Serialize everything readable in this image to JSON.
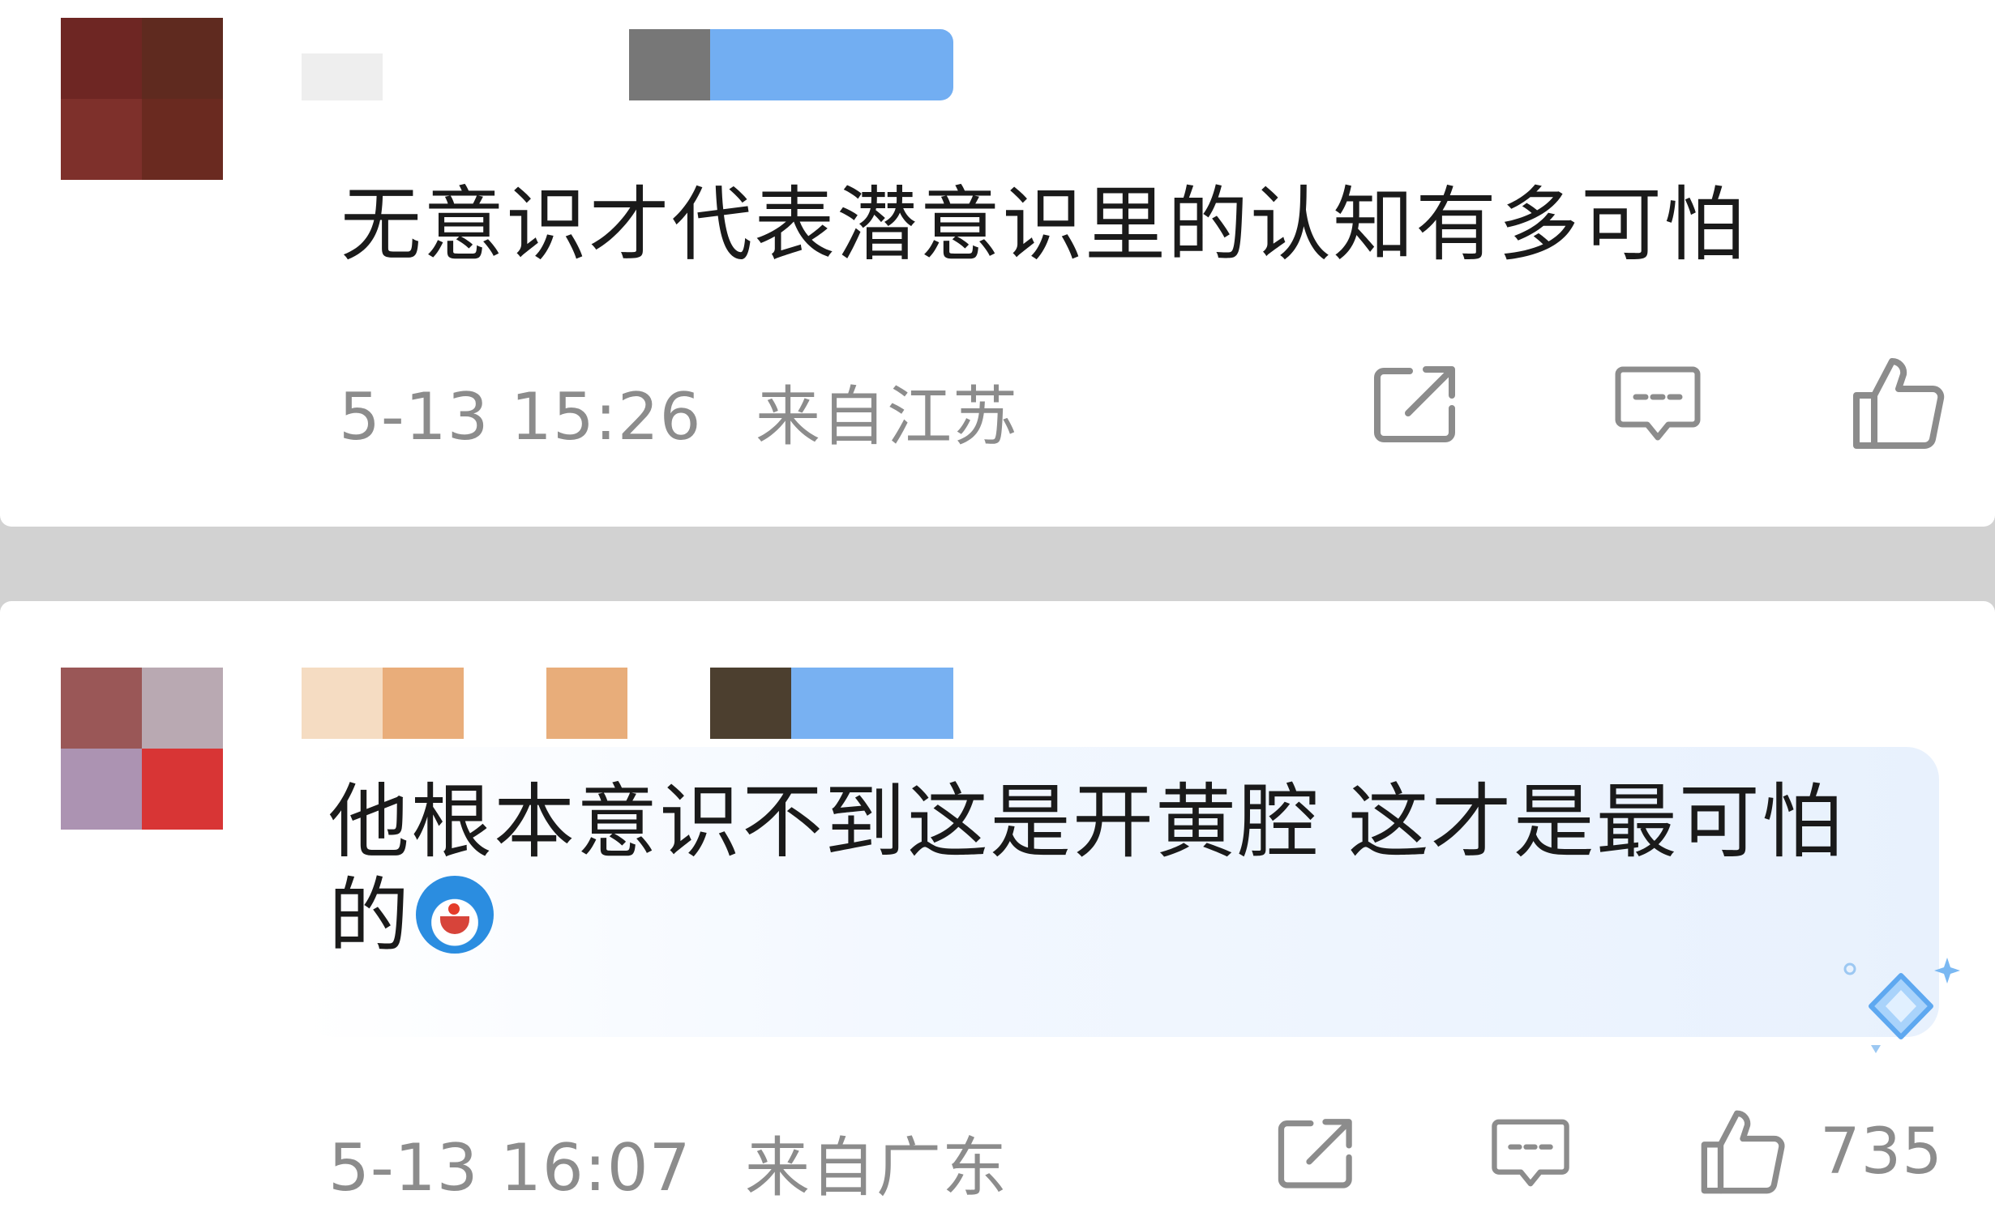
{
  "comments": [
    {
      "text": "无意识才代表潜意识里的认知有多可怕",
      "time": "5-13 15:26",
      "location": "来自江苏",
      "likes": "",
      "avatar_colors": [
        "#6e2623",
        "#5f2a1f",
        "#7e302b",
        "#6a2a20",
        "#5d4540",
        "#62251d"
      ],
      "name_colors": [
        "#eeeeee",
        "#777777",
        "#6aaaf2",
        "#82b4ea",
        "#70b0f4"
      ]
    },
    {
      "text_line1": "他根本意识不到这是开黄腔 这才是最可怕",
      "text_line2": "的",
      "emoji": "doraemon-emoji",
      "time": "5-13 16:07",
      "location": "来自广东",
      "likes": "735",
      "avatar_colors": [
        "#9a5757",
        "#b9a9b2",
        "#ac93b2",
        "#d83535"
      ],
      "name_colors": [
        "#f5dcc2",
        "#e9ad7a",
        "#e8ad7a",
        "#4c3f2f",
        "#76aff2",
        "#7ab3f0"
      ]
    }
  ],
  "icons": {
    "share": "share-icon",
    "reply": "reply-icon",
    "like": "thumbs-up-icon",
    "badge": "diamond-sparkle-icon"
  },
  "colors": {
    "text": "#1a1a1a",
    "meta": "#8c8c8c",
    "divider": "#d2d2d2",
    "highlight": "#e8f1fd",
    "accent": "#4aa0f0"
  }
}
